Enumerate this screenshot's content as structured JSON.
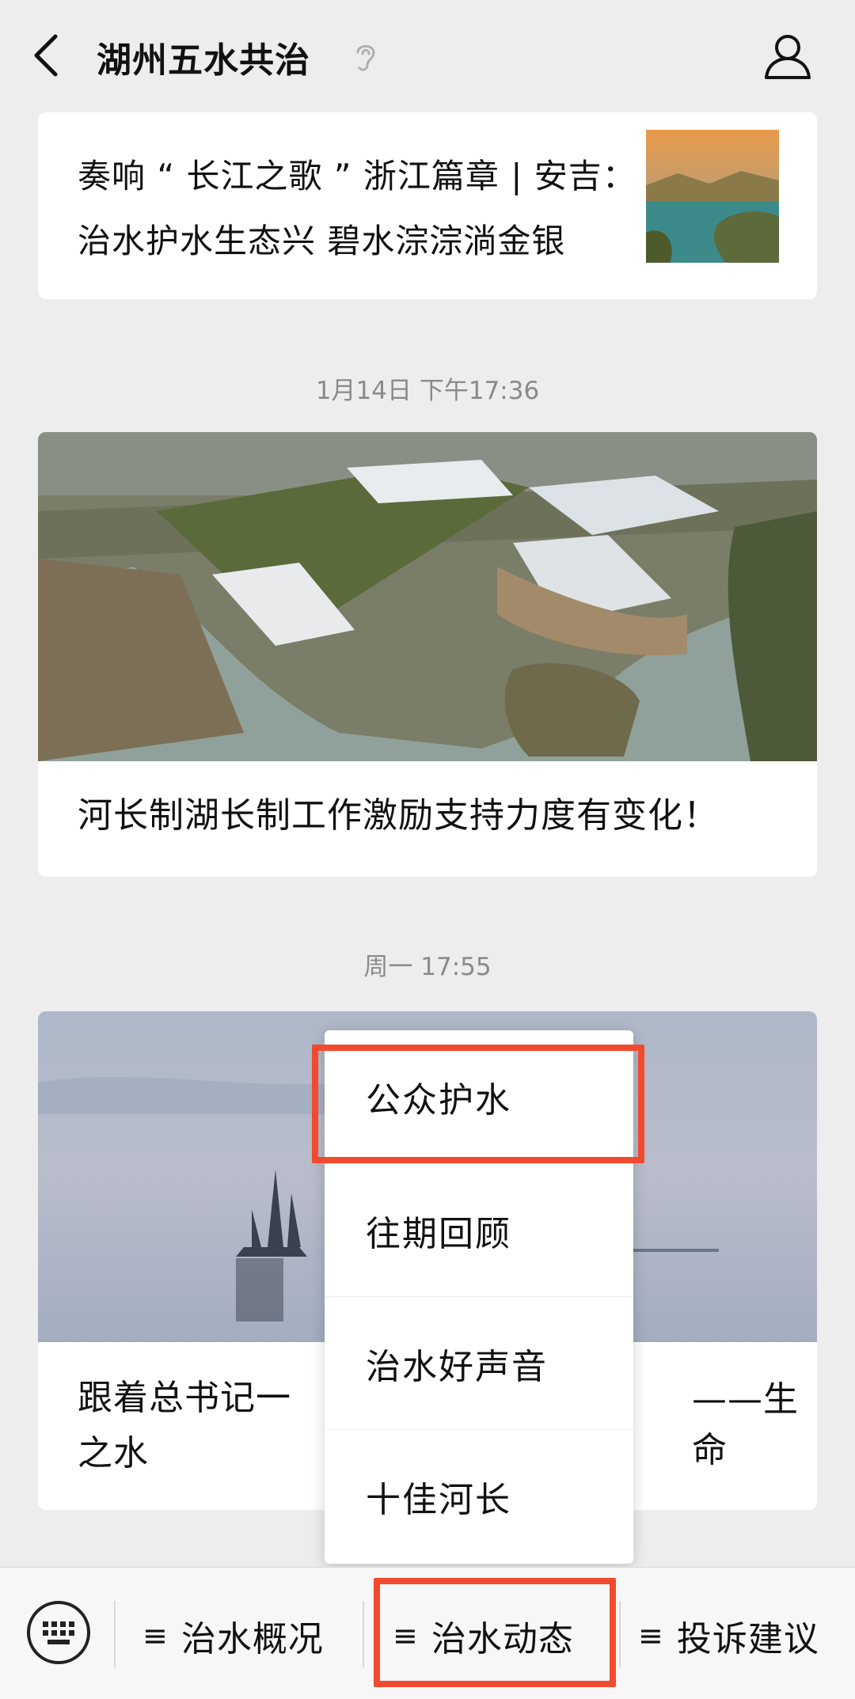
{
  "header": {
    "title": "湖州五水共治"
  },
  "messages": [
    {
      "title": "奏响 “ 长江之歌 ” 浙江篇章 | 安吉：治水护水生态兴 碧水淙淙淌金银"
    },
    {
      "timestamp": "1月14日 下午17:36",
      "title": "河长制湖长制工作激励支持力度有变化！"
    },
    {
      "timestamp": "周一 17:55",
      "title_left": "跟着总书记一",
      "title_right": "——生命",
      "title_line2": "之水"
    }
  ],
  "popup_menu": {
    "items": [
      "公众护水",
      "往期回顾",
      "治水好声音",
      "十佳河长"
    ]
  },
  "bottom_menu": {
    "items": [
      "治水概况",
      "治水动态",
      "投诉建议"
    ],
    "menu_symbol": "≡"
  },
  "colors": {
    "highlight": "#f24a2e",
    "background": "#ededed"
  }
}
